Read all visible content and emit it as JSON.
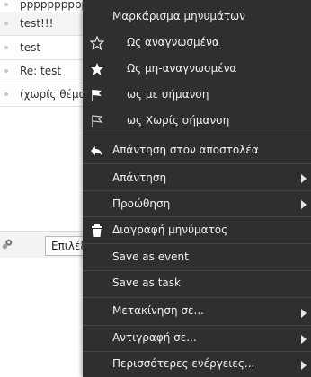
{
  "message_list": {
    "rows": [
      {
        "subject": "pppppppppp"
      },
      {
        "subject": "test!!!"
      },
      {
        "subject": "test"
      },
      {
        "subject": "Re: test"
      },
      {
        "subject": "(χωρίς θέμα)"
      }
    ],
    "select_button_label": "Επιλέξτε"
  },
  "context_menu": {
    "title": "Μαρκάρισμα μηνυμάτων",
    "items": [
      {
        "label": "Ως αναγνωσμένα",
        "icon": "star-outline-icon"
      },
      {
        "label": "Ως μη-αναγνωσμένα",
        "icon": "star-filled-icon"
      },
      {
        "label": "ως με σήμανση",
        "icon": "flag-icon"
      },
      {
        "label": "ως Χωρίς σήμανση",
        "icon": "flag-outline-icon"
      },
      {
        "label": "Απάντηση στον αποστολέα",
        "icon": "reply-icon"
      },
      {
        "label": "Απάντηση",
        "submenu": true
      },
      {
        "label": "Προώθηση",
        "submenu": true
      },
      {
        "label": "Διαγραφή μηνύματος",
        "icon": "trash-icon"
      },
      {
        "label": "Save as event"
      },
      {
        "label": "Save as task"
      },
      {
        "label": "Μετακίνηση σε...",
        "submenu": true
      },
      {
        "label": "Αντιγραφή σε...",
        "submenu": true
      },
      {
        "label": "Περισσότερες ενέργειες...",
        "submenu": true
      }
    ]
  },
  "colors": {
    "menu_bg": "#2f2f2f",
    "menu_text": "#f0f0f0"
  }
}
